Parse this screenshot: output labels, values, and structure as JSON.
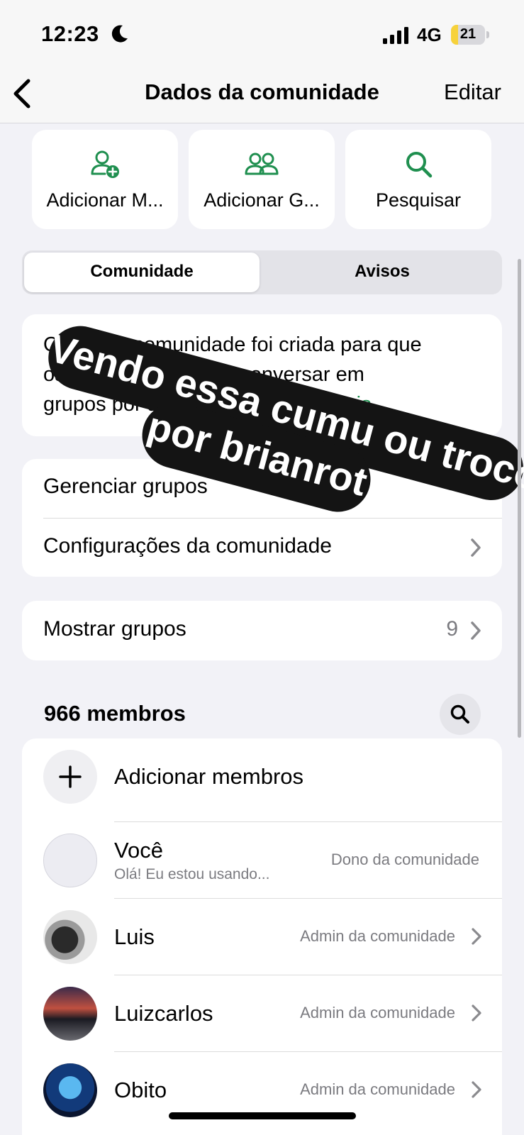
{
  "status": {
    "time": "12:23",
    "network": "4G",
    "battery": "21",
    "battery_level": 0.21
  },
  "nav": {
    "title": "Dados da comunidade",
    "edit": "Editar"
  },
  "quick_actions": [
    {
      "label": "Adicionar M...",
      "icon": "add-person-icon"
    },
    {
      "label": "Adicionar G...",
      "icon": "group-icon"
    },
    {
      "label": "Pesquisar",
      "icon": "search-icon"
    }
  ],
  "tabs": [
    {
      "label": "Comunidade",
      "selected": true
    },
    {
      "label": "Avisos",
      "selected": false
    }
  ],
  "description": {
    "line1": "Olá! Esta comunidade foi criada para que",
    "line2": "os membros possam conversar em",
    "line3": "grupos por assuntos... ",
    "more": "Mostrar mais"
  },
  "settings": [
    {
      "label": "Gerenciar grupos"
    },
    {
      "label": "Configurações da comunidade"
    }
  ],
  "groups": {
    "label": "Mostrar grupos",
    "count": "9"
  },
  "members": {
    "title": "966 membros",
    "add_label": "Adicionar membros",
    "list": [
      {
        "name": "Você",
        "status": "Olá! Eu estou usando...",
        "role": "Dono da comunidade"
      },
      {
        "name": "Luis",
        "role": "Admin da comunidade"
      },
      {
        "name": "Luizcarlos",
        "role": "Admin da comunidade"
      },
      {
        "name": "Obito",
        "role": "Admin da comunidade"
      }
    ]
  },
  "sticker": {
    "line1": "Vendo essa cumu ou troco",
    "line2": "por brianrot"
  },
  "colors": {
    "accent": "#1f8f4f",
    "background": "#f2f2f7",
    "sticker": "#141414"
  }
}
